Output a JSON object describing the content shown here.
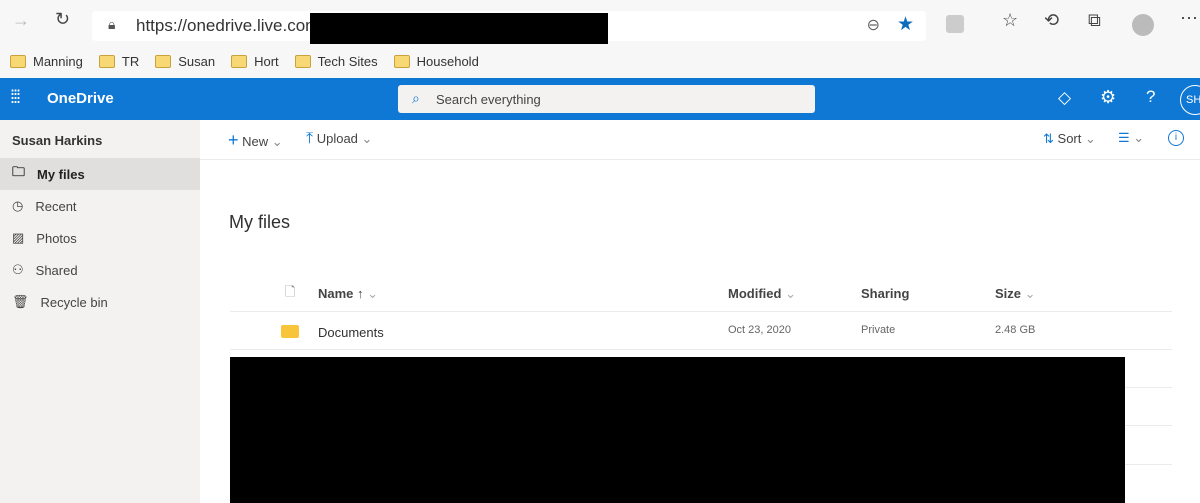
{
  "browser": {
    "url": "https://onedrive.live.com",
    "bookmarks": [
      "Manning",
      "TR",
      "Susan",
      "Hort",
      "Tech Sites",
      "Household"
    ]
  },
  "app": {
    "name": "OneDrive",
    "search_placeholder": "Search everything",
    "avatar": "SH"
  },
  "sidebar": {
    "user": "Susan Harkins",
    "items": [
      {
        "label": "My files"
      },
      {
        "label": "Recent"
      },
      {
        "label": "Photos"
      },
      {
        "label": "Shared"
      },
      {
        "label": "Recycle bin"
      }
    ]
  },
  "commands": {
    "new": "New",
    "upload": "Upload",
    "sort": "Sort"
  },
  "main": {
    "title": "My files",
    "columns": {
      "name": "Name ↑",
      "modified": "Modified",
      "sharing": "Sharing",
      "size": "Size"
    },
    "rows": [
      {
        "name": "Documents",
        "modified": "Oct 23, 2020",
        "sharing": "Private",
        "size": "2.48 GB"
      }
    ]
  }
}
